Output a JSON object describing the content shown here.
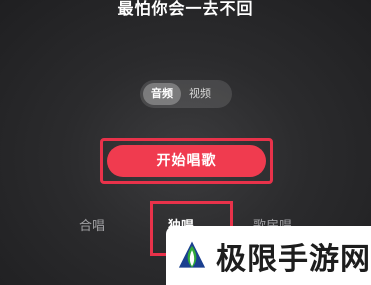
{
  "song": {
    "title": "最怕你会一去不回"
  },
  "media_toggle": {
    "options": [
      "音频",
      "视频"
    ],
    "selected": "音频"
  },
  "start_button": {
    "label": "开始唱歌"
  },
  "modes": {
    "tabs": [
      "合唱",
      "独唱",
      "歌房唱"
    ],
    "selected": "独唱"
  },
  "watermark": {
    "text": "极限手游网",
    "colors": {
      "logo_green": "#2fa83a",
      "logo_dark": "#1a3f8f"
    }
  },
  "colors": {
    "accent": "#f03b4f",
    "highlight_border": "#e8324a"
  }
}
